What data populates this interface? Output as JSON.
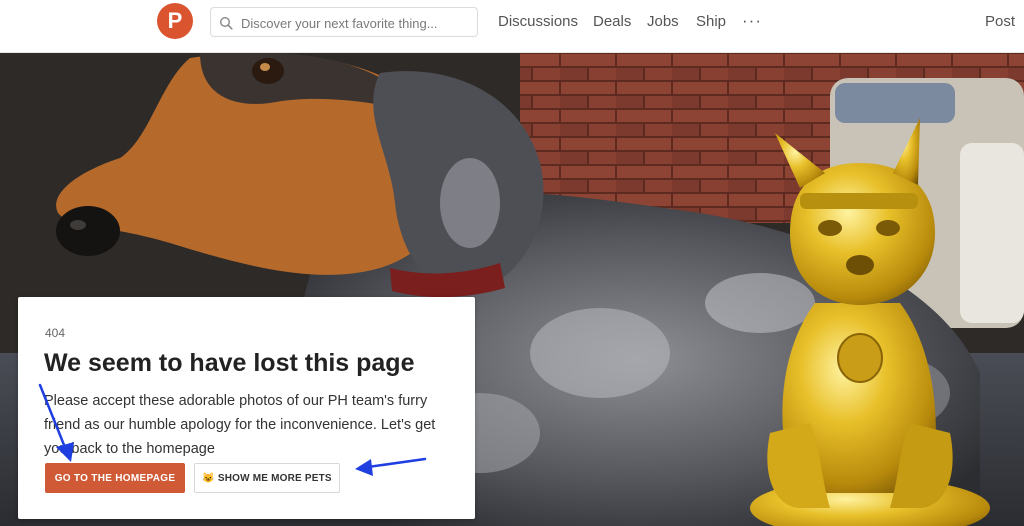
{
  "nav": {
    "logo_letter": "P",
    "search_placeholder": "Discover your next favorite thing...",
    "links": [
      "Discussions",
      "Deals",
      "Jobs",
      "Ship"
    ],
    "more": "···",
    "post": "Post"
  },
  "card": {
    "code": "404",
    "title": "We seem to have lost this page",
    "message": "Please accept these adorable photos of our PH team's furry friend as our humble apology for the inconvenience. Let's get you back to the homepage",
    "home_button": "GO TO THE HOMEPAGE",
    "pets_button_emoji": "😺",
    "pets_button": "SHOW ME MORE PETS"
  },
  "colors": {
    "brand": "#da552f",
    "home_button": "#cf5a35",
    "arrow": "#1f3fe0"
  }
}
